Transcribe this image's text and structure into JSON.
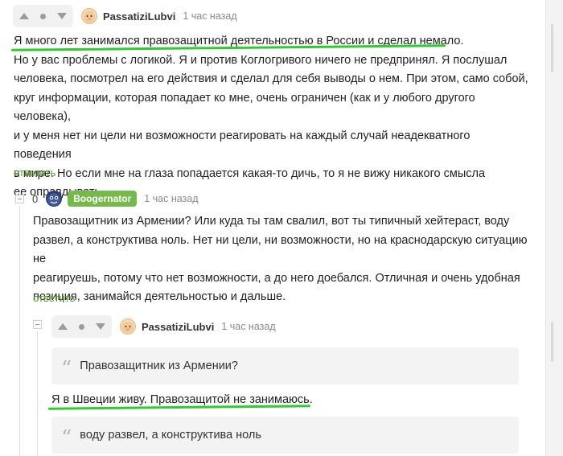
{
  "comments": [
    {
      "author": "PassatiziLubvi",
      "time": "1 час назад",
      "paragraphs": [
        "Я много лет занимался правозащитной деятельностью в России и сделал немало.",
        "Но у вас проблемы с логикой. Я и против Коглогривого ничего не предпринял. Я послушал",
        "человека, посмотрел на его действия и сделал для себя выводы о нем. При этом, само собой,",
        "круг информации, которая попадает ко мне, очень ограничен (как и у любого другого человека),",
        "и у меня нет ни цели ни возможности реагировать на каждый случай неадекватного поведения",
        "в мире. Но если мне на глаза попадается какая-то дичь, то я не вижу никакого смысла",
        "ее оправдывать."
      ],
      "reply": "ответить"
    },
    {
      "votes": "0",
      "author": "Boogernator",
      "time": "1 час назад",
      "paragraphs": [
        "Правозащитник из Армении? Или куда ты там свалил, вот ты типичный хейтераст, воду",
        "развел, а конструктива ноль. Нет ни цели, ни возможности, но на краснодарскую ситуацию не",
        "реагируешь, потому что нет возможности, а до него доебался. Отличная и очень удобная",
        "позиция, занимайся деятельностью и дальше."
      ],
      "reply": "ответить"
    },
    {
      "author": "PassatiziLubvi",
      "time": "1 час назад",
      "quote1": "Правозащитник из Армении?",
      "text1": "Я в Швеции живу. Правозащитой не занимаюсь.",
      "quote2": "воду развел, а конструктива ноль"
    }
  ],
  "colors": {
    "accent_green": "#75b94a",
    "underline_green": "#2ecc2e",
    "reply_link": "#5a9a31"
  },
  "icons": [
    "arrow-up-icon",
    "dot-icon",
    "arrow-down-icon",
    "collapse-icon",
    "quote-icon",
    "hamster-avatar",
    "monster-avatar"
  ]
}
